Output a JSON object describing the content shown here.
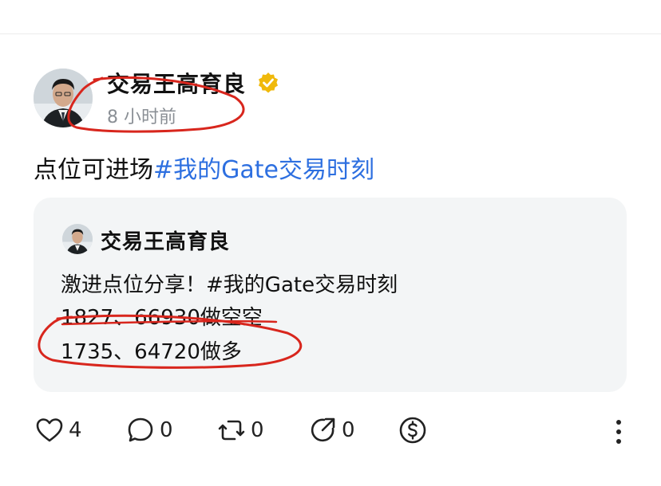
{
  "post": {
    "author": "交易王高育良",
    "time_ago": "8 小时前",
    "text": "点位可进场",
    "hashtag": "#我的Gate交易时刻"
  },
  "quote": {
    "author": "交易王高育良",
    "line1_text": "激进点位分享！",
    "line1_hashtag": "#我的Gate交易时刻",
    "line2": "1827、66930做空空",
    "line3": "1735、64720做多"
  },
  "actions": {
    "likes": "4",
    "replies": "0",
    "reposts": "0",
    "shares": "0"
  },
  "icons": {
    "verified": "verified-badge-icon",
    "like": "heart-icon",
    "reply": "comment-icon",
    "repost": "repost-icon",
    "share": "share-icon",
    "tip": "dollar-coin-icon",
    "more": "more-vertical-icon"
  },
  "colors": {
    "hashtag": "#2d6fe0",
    "verified": "#f0b90b",
    "annotation": "#d8261d",
    "card_bg": "#f3f5f6"
  }
}
